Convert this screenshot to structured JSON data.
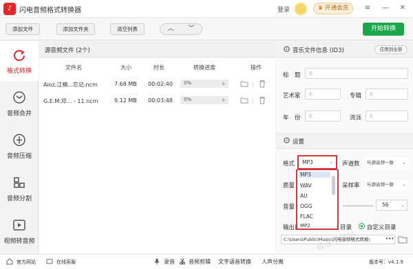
{
  "app": {
    "logo_glyph": "♪",
    "title": "闪电音频格式转换器"
  },
  "titlebar": {
    "login": "登录",
    "vip_label": "开通会员",
    "vip_icon": "crown-icon",
    "menu_glyph": "≡",
    "minimize_glyph": "—",
    "close_glyph": "✕"
  },
  "toolbar": {
    "add_file": "添加文件",
    "add_folder": "添加文件夹",
    "clear_list": "清空列表",
    "up_glyph": "︿",
    "down_glyph": "﹀",
    "start": "开始转换"
  },
  "sidebar": {
    "items": [
      {
        "label": "格式转换",
        "icon": "refresh-icon",
        "active": true
      },
      {
        "label": "音频合并",
        "icon": "merge-icon",
        "active": false
      },
      {
        "label": "音频压缩",
        "icon": "compress-icon",
        "active": false
      },
      {
        "label": "音频分割",
        "icon": "split-icon",
        "active": false
      },
      {
        "label": "视频转音频",
        "icon": "video-icon",
        "active": false
      }
    ]
  },
  "filelist": {
    "header": "源音频文件 (2个)",
    "columns": [
      "文件名",
      "大小",
      "时长",
      "转换进度",
      "操作"
    ],
    "rows": [
      {
        "name": "Aioz,江楠...忘记.ncm",
        "size": "7.68 MB",
        "duration": "00:02:40",
        "progress": "0%"
      },
      {
        "name": "G.E.M.邓... - 11.ncm",
        "size": "9.12 MB",
        "duration": "00:03:48",
        "progress": "0%"
      }
    ]
  },
  "id3": {
    "title": "音乐文件信息 (ID3)",
    "apply_all": "应用到全部",
    "fields": {
      "title_label": "标　题",
      "artist_label": "艺术家",
      "album_label": "专辑",
      "year_label": "年　份",
      "genre_label": "流派",
      "placeholder": "无"
    }
  },
  "settings": {
    "title": "设置",
    "format_label": "格式",
    "format_value": "MP3",
    "channels_label": "声道数",
    "channels_value": "与源音频一致",
    "quality_label": "质量",
    "samplerate_label": "采样率",
    "samplerate_value": "与源音频一致",
    "volume_label": "音量",
    "volume_value": "56",
    "volume_fraction": 0.56,
    "output_label": "输出目",
    "source_dir_label": "目录",
    "custom_dir_label": "自定义目录",
    "output_path": "C:\\Users\\Public\\Music\\闪电音频格式转换\\",
    "more_glyph": "•••",
    "format_options": [
      "MP3",
      "WAV",
      "AU",
      "OGG",
      "FLAC",
      "MP2"
    ]
  },
  "bottombar": {
    "website": "官方网站",
    "support": "在线客服",
    "record": "录音",
    "edit": "音频剪辑",
    "tts": "文字语音转换",
    "vocal": "人声分离",
    "version": "版本号：v4.1.9"
  },
  "watermark": "极速下载站",
  "colors": {
    "accent_red": "#d6282b",
    "start_green": "#1ca64b",
    "highlight_border": "#d9323a"
  }
}
